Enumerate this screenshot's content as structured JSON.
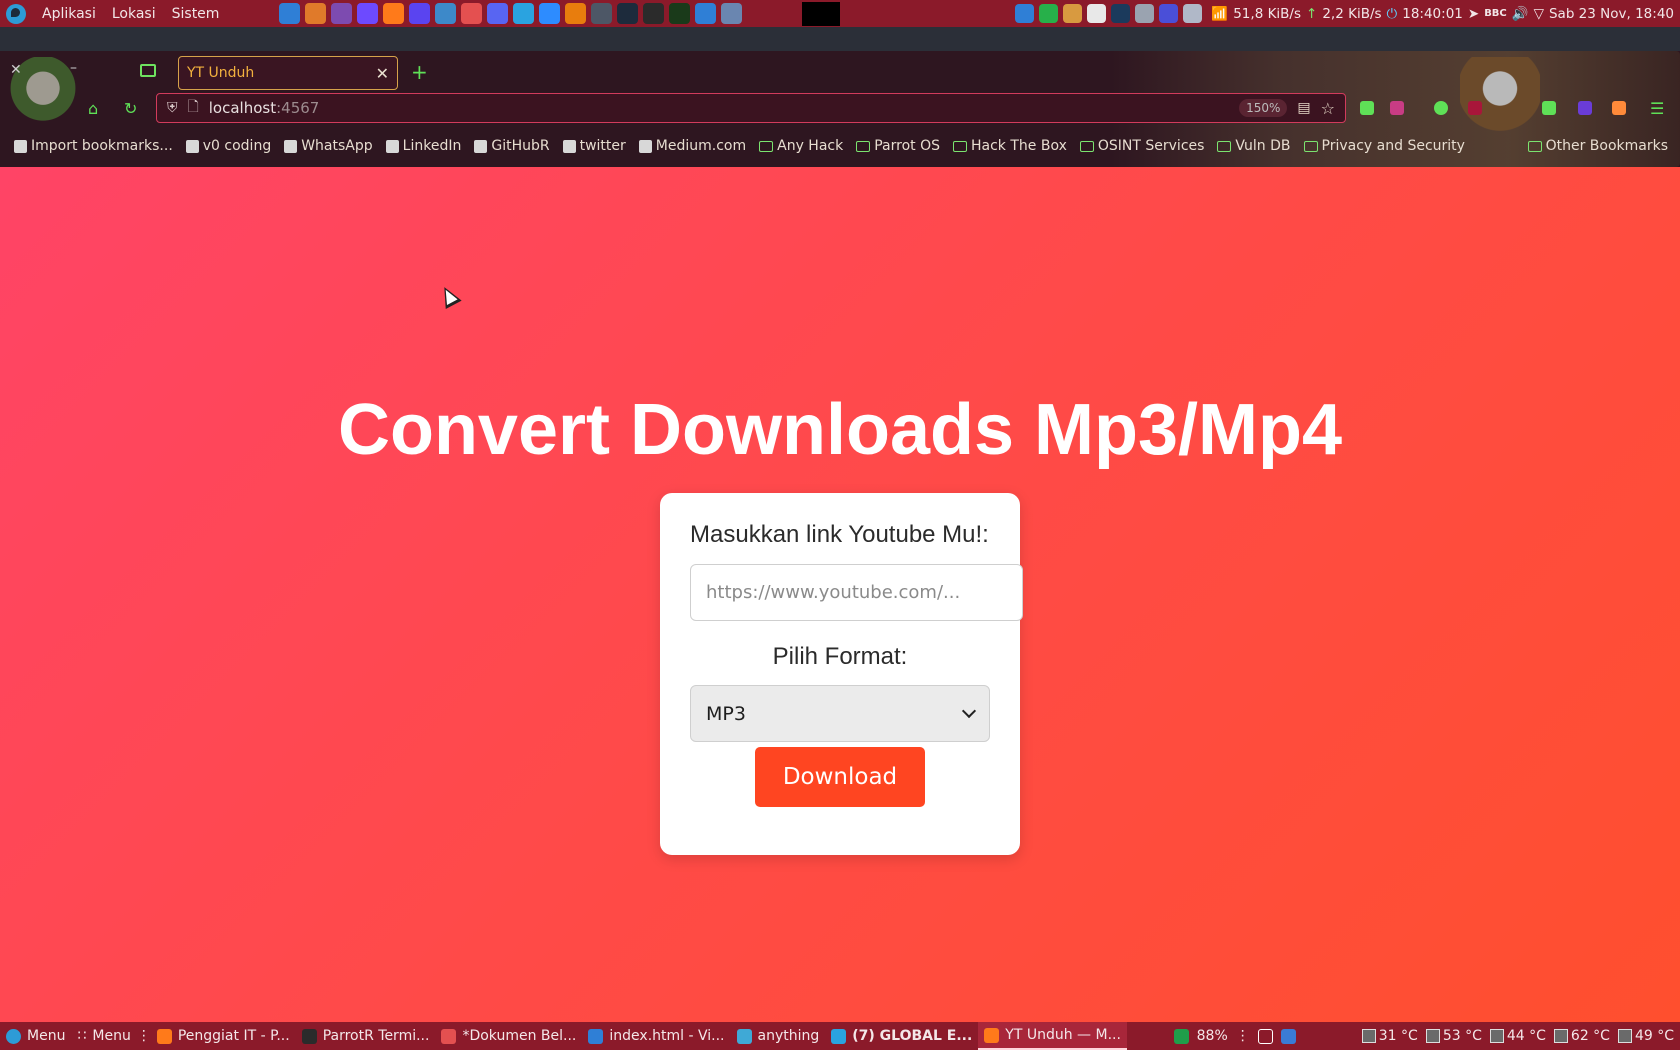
{
  "top_panel": {
    "menus": [
      "Aplikasi",
      "Lokasi",
      "Sistem"
    ],
    "launchers": [
      {
        "icon": "vscode-icon",
        "color": "#2f7fd6"
      },
      {
        "icon": "burp-icon",
        "color": "#e07a2a"
      },
      {
        "icon": "tor-icon",
        "color": "#7d4bb0"
      },
      {
        "icon": "proton-icon",
        "color": "#6d4aff"
      },
      {
        "icon": "firefox-icon",
        "color": "#ff7a1a"
      },
      {
        "icon": "brave-icon",
        "color": "#5a44f0"
      },
      {
        "icon": "network-icon",
        "color": "#3d89c9"
      },
      {
        "icon": "text-editor-icon",
        "color": "#e45050"
      },
      {
        "icon": "discord-icon",
        "color": "#5865f2"
      },
      {
        "icon": "telegram-icon",
        "color": "#2aa3e0"
      },
      {
        "icon": "zoom-icon",
        "color": "#2d8cff"
      },
      {
        "icon": "blender-icon",
        "color": "#e87d0d"
      },
      {
        "icon": "grid-icon",
        "color": "#4d5766"
      },
      {
        "icon": "security-icon",
        "color": "#1d2b3c"
      },
      {
        "icon": "terminal-icon",
        "color": "#2b2b2b"
      },
      {
        "icon": "terminal-root-icon",
        "color": "#1a3a1a"
      },
      {
        "icon": "monitor-icon",
        "color": "#2f7fd6"
      },
      {
        "icon": "screenshot-icon",
        "color": "#6a86b0"
      }
    ],
    "tray_icons": [
      {
        "icon": "qbittorrent-icon",
        "color": "#2f7fd6"
      },
      {
        "icon": "update-icon",
        "color": "#27b04a"
      },
      {
        "icon": "usb-icon",
        "color": "#d89a40"
      },
      {
        "icon": "github-tray-icon",
        "color": "#e8e8e8"
      },
      {
        "icon": "steam-icon",
        "color": "#1b3a5c"
      },
      {
        "icon": "cpu-icon",
        "color": "#9aa3b0"
      },
      {
        "icon": "clipboard-icon",
        "color": "#4a4fd8"
      },
      {
        "icon": "puzzle-icon",
        "color": "#b0b8c8"
      }
    ],
    "net_down": "51,8 KiB/s",
    "net_up": "2,2 KiB/s",
    "clock": "18:40:01",
    "datetime": "Sab 23 Nov, 18:40"
  },
  "browser": {
    "tab_title": "YT Unduh",
    "url_host": "localhost",
    "url_port": ":4567",
    "zoom": "150%",
    "bookmarks": [
      {
        "label": "Import bookmarks...",
        "icon": "import-icon",
        "folder": false
      },
      {
        "label": "v0 coding",
        "icon": "v0-icon",
        "folder": false
      },
      {
        "label": "WhatsApp",
        "icon": "whatsapp-icon",
        "folder": false
      },
      {
        "label": "LinkedIn",
        "icon": "linkedin-icon",
        "folder": false
      },
      {
        "label": "GitHubR",
        "icon": "github-icon",
        "folder": false
      },
      {
        "label": "twitter",
        "icon": "x-icon",
        "folder": false
      },
      {
        "label": "Medium.com",
        "icon": "medium-icon",
        "folder": false
      },
      {
        "label": "Any Hack",
        "icon": "folder-icon",
        "folder": true
      },
      {
        "label": "Parrot OS",
        "icon": "folder-icon",
        "folder": true
      },
      {
        "label": "Hack The Box",
        "icon": "folder-icon",
        "folder": true
      },
      {
        "label": "OSINT Services",
        "icon": "folder-icon",
        "folder": true
      },
      {
        "label": "Vuln DB",
        "icon": "folder-icon",
        "folder": true
      },
      {
        "label": "Privacy and Security",
        "icon": "folder-icon",
        "folder": true
      }
    ],
    "other_bookmarks": "Other Bookmarks"
  },
  "page": {
    "title": "Convert Downloads Mp3/Mp4",
    "link_label": "Masukkan link Youtube Mu!:",
    "link_placeholder": "https://www.youtube.com/...",
    "format_label": "Pilih Format:",
    "format_selected": "MP3",
    "download_label": "Download",
    "colors": {
      "gradient_start": "#ff4466",
      "gradient_end": "#ff4f2e",
      "button": "#ff4521"
    }
  },
  "taskbar": {
    "menu1": "Menu",
    "menu2": "Menu",
    "items": [
      {
        "label": "Penggiat IT - P...",
        "icon": "firefox-icon",
        "color": "#ff7a1a",
        "active": false,
        "bold": false
      },
      {
        "label": "ParrotR Termi...",
        "icon": "terminal-icon",
        "color": "#2b2b2b",
        "active": false,
        "bold": false
      },
      {
        "label": "*Dokumen Bel...",
        "icon": "text-editor-icon",
        "color": "#e45050",
        "active": false,
        "bold": false
      },
      {
        "label": "index.html - Vi...",
        "icon": "vscode-icon",
        "color": "#2f7fd6",
        "active": false,
        "bold": false
      },
      {
        "label": "anything",
        "icon": "folder-icon",
        "color": "#3fa9d6",
        "active": false,
        "bold": false
      },
      {
        "label": "(7) GLOBAL E...",
        "icon": "telegram-icon",
        "color": "#2aa3e0",
        "active": false,
        "bold": true
      },
      {
        "label": "YT Unduh — M...",
        "icon": "firefox-icon",
        "color": "#ff7a1a",
        "active": true,
        "bold": false
      }
    ],
    "battery": "88%",
    "temps": [
      "31 °C",
      "53 °C",
      "44 °C",
      "62 °C",
      "49 °C"
    ]
  }
}
